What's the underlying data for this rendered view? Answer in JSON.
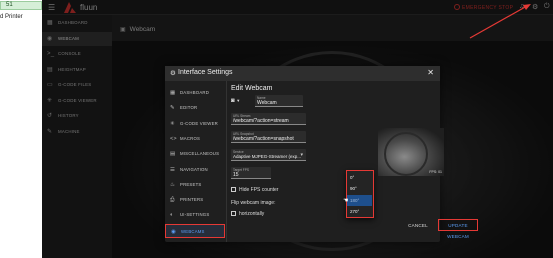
{
  "desktop": {
    "tab_label": "51",
    "side_text": "d Printer"
  },
  "app": {
    "title": "fluun",
    "estop_label": "EMERGENCY STOP",
    "sidebar": [
      {
        "label": "DASHBOARD",
        "icon": "dashboard-icon",
        "glyph": "▦"
      },
      {
        "label": "WEBCAM",
        "icon": "webcam-icon",
        "glyph": "◉"
      },
      {
        "label": "CONSOLE",
        "icon": "console-icon",
        "glyph": ">_"
      },
      {
        "label": "HEIGHTMAP",
        "icon": "heightmap-icon",
        "glyph": "▤"
      },
      {
        "label": "G-CODE FILES",
        "icon": "files-icon",
        "glyph": "▭"
      },
      {
        "label": "G-CODE VIEWER",
        "icon": "viewer-icon",
        "glyph": "✳"
      },
      {
        "label": "HISTORY",
        "icon": "history-icon",
        "glyph": "↺"
      },
      {
        "label": "MACHINE",
        "icon": "wrench-icon",
        "glyph": "✎"
      }
    ],
    "page_title": "Webcam"
  },
  "dialog": {
    "title": "Interface Settings",
    "nav": [
      {
        "label": "DASHBOARD",
        "icon": "dashboard-icon",
        "glyph": "▦"
      },
      {
        "label": "EDITOR",
        "icon": "editor-icon",
        "glyph": "✎"
      },
      {
        "label": "G-CODE VIEWER",
        "icon": "viewer-icon",
        "glyph": "✳"
      },
      {
        "label": "MACROS",
        "icon": "macros-icon",
        "glyph": "<>"
      },
      {
        "label": "MISCELLANEOUS",
        "icon": "misc-icon",
        "glyph": "▤"
      },
      {
        "label": "NAVIGATION",
        "icon": "navigation-icon",
        "glyph": "☰"
      },
      {
        "label": "PRESETS",
        "icon": "presets-icon",
        "glyph": "♨"
      },
      {
        "label": "PRINTERS",
        "icon": "printers-icon",
        "glyph": "⎙"
      },
      {
        "label": "UI-SETTINGS",
        "icon": "palette-icon",
        "glyph": "◐"
      },
      {
        "label": "WEBCAMS",
        "icon": "webcam-icon",
        "glyph": "◉"
      }
    ],
    "form": {
      "title": "Edit Webcam",
      "name_label": "Name",
      "name_value": "Webcam",
      "stream_label": "URL Stream",
      "stream_value": "/webcam/?action=stream",
      "snapshot_label": "URL Snapshot",
      "snapshot_value": "/webcam/?action=snapshot",
      "service_label": "Service",
      "service_value": "Adaptive MJPEG-Streamer (exp...",
      "fps_label": "Target FPS",
      "fps_value": "15",
      "hide_fps_label": "Hide FPS counter",
      "flip_label": "Flip webcam image:",
      "horizontally_label": "horizontally",
      "preview_fps": "FPS: 01"
    },
    "rotation_options": [
      "0°",
      "90°",
      "180°",
      "270°"
    ],
    "selected_rotation_index": 2,
    "cancel_label": "CANCEL",
    "update_label": "UPDATE WEBCAM"
  },
  "colors": {
    "accent_blue": "#5b9df5",
    "highlight_red": "#e53935",
    "emergency_red": "#e53935"
  }
}
